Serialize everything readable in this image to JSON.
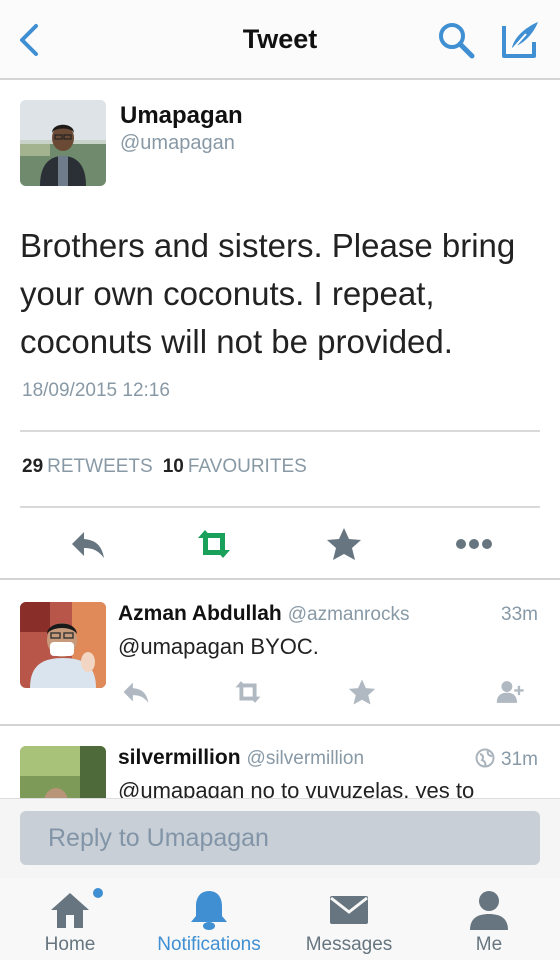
{
  "header": {
    "title": "Tweet",
    "accent": "#3f8fd2"
  },
  "tweet": {
    "author_name": "Umapagan",
    "author_handle": "@umapagan",
    "text": "Brothers and sisters. Please bring your own coconuts. I repeat, coconuts will not be provided.",
    "timestamp": "18/09/2015 12:16",
    "retweets_count": "29",
    "retweets_label": "RETWEETS",
    "favourites_count": "10",
    "favourites_label": "FAVOURITES",
    "retweet_color": "#19a05b"
  },
  "replies": [
    {
      "name": "Azman Abdullah",
      "handle": "@azmanrocks",
      "time": "33m",
      "text": "@umapagan BYOC."
    },
    {
      "name": "silvermillion",
      "handle": "@silvermillion",
      "time": "31m",
      "text": "@umapagan no to vuvuzelas, yes to"
    }
  ],
  "reply_bar": {
    "placeholder": "Reply to Umapagan"
  },
  "tabs": [
    {
      "label": "Home",
      "icon": "home-icon",
      "has_notification_dot": true
    },
    {
      "label": "Notifications",
      "icon": "bell-icon",
      "active": true
    },
    {
      "label": "Messages",
      "icon": "envelope-icon"
    },
    {
      "label": "Me",
      "icon": "person-icon"
    }
  ]
}
